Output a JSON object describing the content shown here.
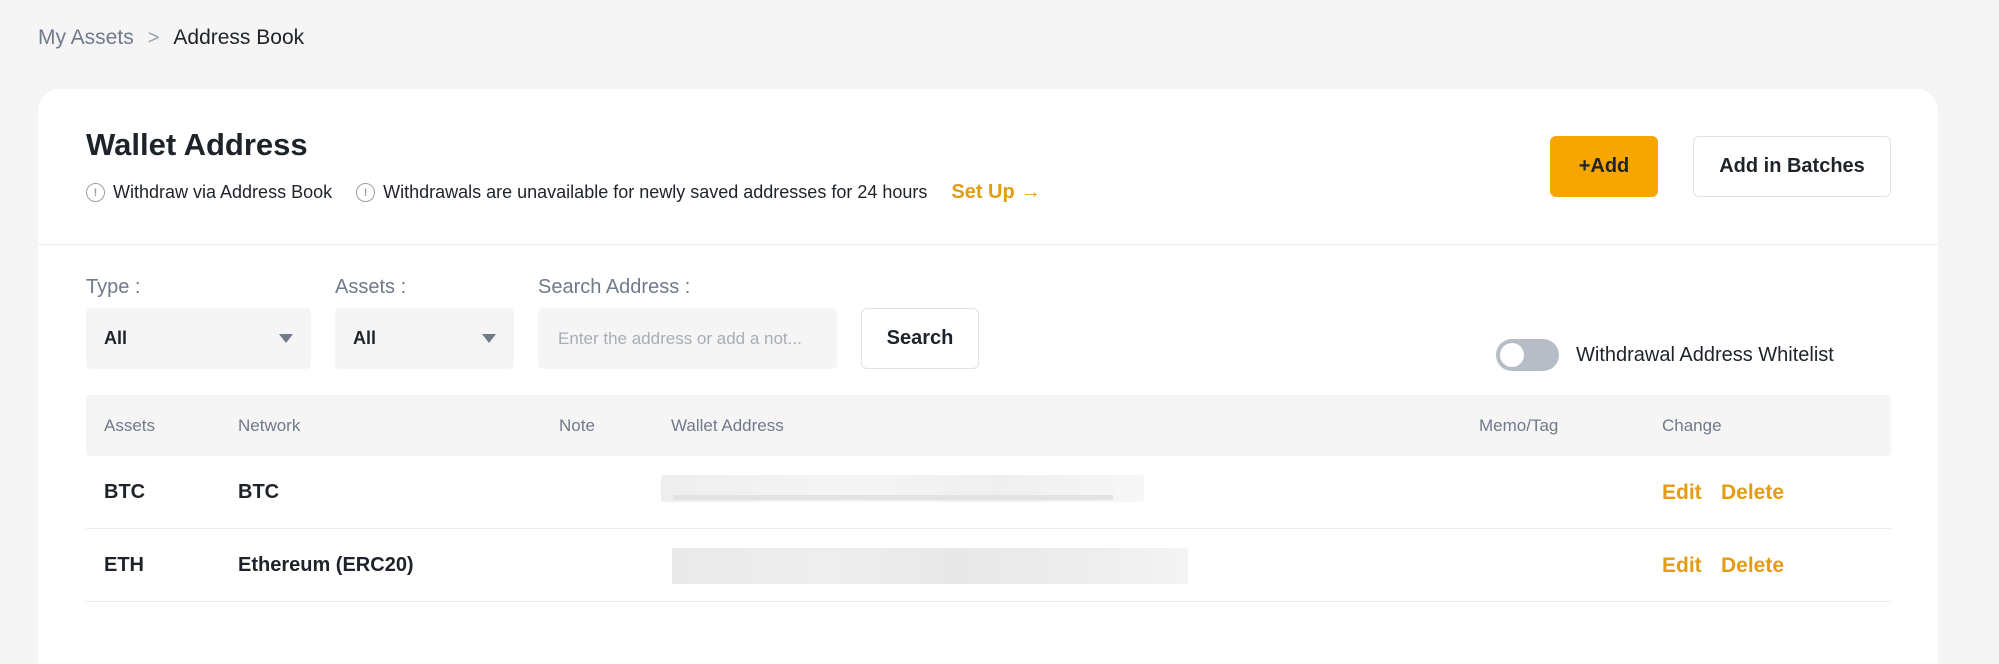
{
  "breadcrumb": {
    "parent": "My Assets",
    "separator": ">",
    "current": "Address Book"
  },
  "header": {
    "title": "Wallet Address",
    "notes": [
      "Withdraw via Address Book",
      "Withdrawals are unavailable for newly saved addresses for 24 hours"
    ],
    "setup_link": "Set Up",
    "setup_arrow": "→",
    "add_button": "+Add",
    "add_batches_button": "Add in Batches"
  },
  "filters": {
    "type_label": "Type :",
    "type_value": "All",
    "assets_label": "Assets :",
    "assets_value": "All",
    "search_label": "Search Address :",
    "search_placeholder": "Enter the address or add a not...",
    "search_button": "Search"
  },
  "whitelist": {
    "label": "Withdrawal Address Whitelist",
    "enabled": false
  },
  "table": {
    "columns": [
      "Assets",
      "Network",
      "Note",
      "Wallet Address",
      "Memo/Tag",
      "Change"
    ],
    "rows": [
      {
        "asset": "BTC",
        "network": "BTC",
        "note": "",
        "address": "",
        "memo": "",
        "edit": "Edit",
        "delete": "Delete"
      },
      {
        "asset": "ETH",
        "network": "Ethereum (ERC20)",
        "note": "",
        "address": "",
        "memo": "",
        "edit": "Edit",
        "delete": "Delete"
      }
    ]
  },
  "colors": {
    "accent": "#f7a600",
    "link": "#e49c13",
    "background": "#f5f5f5",
    "card": "#ffffff"
  },
  "icons": {
    "info": "info-circle-icon",
    "caret": "caret-down-icon",
    "breadcrumb_sep": "chevron-right-icon",
    "arrow": "arrow-right-icon"
  }
}
